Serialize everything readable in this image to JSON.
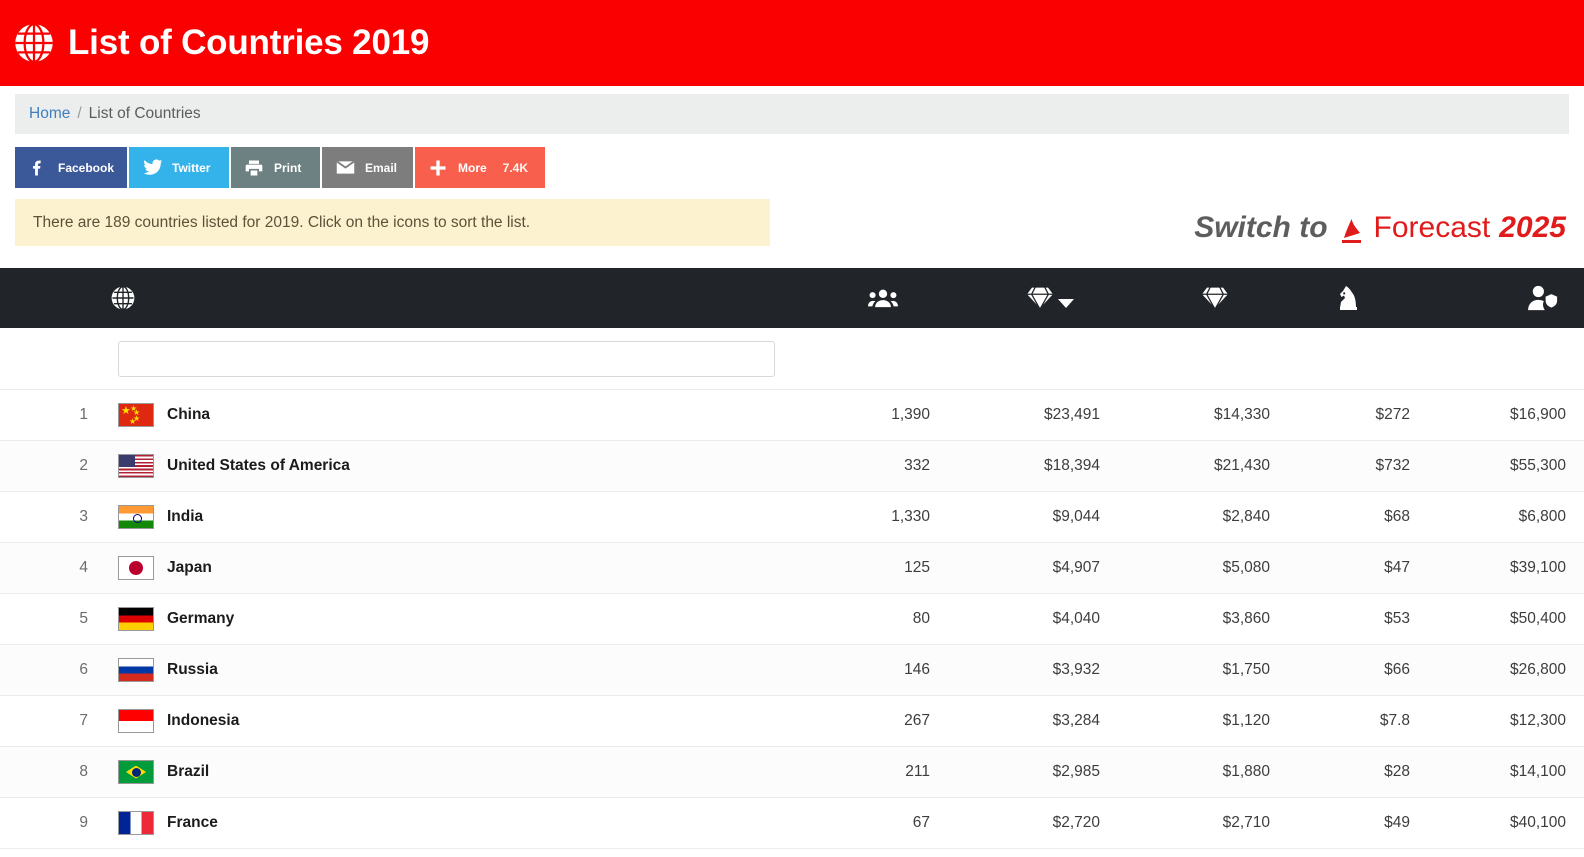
{
  "header": {
    "title": "List of Countries 2019",
    "logo_icon": "globe-icon",
    "background_color": "#fb0000"
  },
  "breadcrumb": {
    "home_label": "Home",
    "separator": "/",
    "current_label": "List of Countries"
  },
  "share_buttons": [
    {
      "name": "facebook",
      "label": "Facebook",
      "icon": "facebook-icon",
      "color": "#3b5998",
      "count": ""
    },
    {
      "name": "twitter",
      "label": "Twitter",
      "icon": "twitter-icon",
      "color": "#34b3eb",
      "count": ""
    },
    {
      "name": "print",
      "label": "Print",
      "icon": "printer-icon",
      "color": "#6d8183",
      "count": ""
    },
    {
      "name": "email",
      "label": "Email",
      "icon": "envelope-icon",
      "color": "#7d7d7d",
      "count": ""
    },
    {
      "name": "more",
      "label": "More",
      "icon": "plus-icon",
      "color": "#f8604d",
      "count": "7.4K"
    }
  ],
  "notice": {
    "text": "There are 189 countries listed for 2019. Click on the icons to sort the list.",
    "background_color": "#fdf2cf"
  },
  "forecast_link": {
    "prefix": "Switch to",
    "brand_icon": "a-mark-icon",
    "label": "Forecast",
    "year": "2025",
    "accent_color": "#e01b1b"
  },
  "table": {
    "header_background": "#212529",
    "columns": [
      {
        "key": "country",
        "icon": "globe-icon",
        "sorted": false,
        "sort_direction": ""
      },
      {
        "key": "population",
        "icon": "users-icon",
        "sorted": false,
        "sort_direction": ""
      },
      {
        "key": "gdp",
        "icon": "gem-icon",
        "sorted": true,
        "sort_direction": "desc"
      },
      {
        "key": "debt",
        "icon": "gem-icon",
        "sorted": false,
        "sort_direction": ""
      },
      {
        "key": "military",
        "icon": "chess-knight-icon",
        "sorted": false,
        "sort_direction": ""
      },
      {
        "key": "per_capita",
        "icon": "user-shield-icon",
        "sorted": false,
        "sort_direction": ""
      }
    ],
    "search": {
      "value": "",
      "placeholder": ""
    },
    "rows": [
      {
        "rank": "1",
        "flag": "cn",
        "country": "China",
        "population": "1,390",
        "gdp": "$23,491",
        "debt": "$14,330",
        "military": "$272",
        "per_capita": "$16,900"
      },
      {
        "rank": "2",
        "flag": "us",
        "country": "United States of America",
        "population": "332",
        "gdp": "$18,394",
        "debt": "$21,430",
        "military": "$732",
        "per_capita": "$55,300"
      },
      {
        "rank": "3",
        "flag": "in",
        "country": "India",
        "population": "1,330",
        "gdp": "$9,044",
        "debt": "$2,840",
        "military": "$68",
        "per_capita": "$6,800"
      },
      {
        "rank": "4",
        "flag": "jp",
        "country": "Japan",
        "population": "125",
        "gdp": "$4,907",
        "debt": "$5,080",
        "military": "$47",
        "per_capita": "$39,100"
      },
      {
        "rank": "5",
        "flag": "de",
        "country": "Germany",
        "population": "80",
        "gdp": "$4,040",
        "debt": "$3,860",
        "military": "$53",
        "per_capita": "$50,400"
      },
      {
        "rank": "6",
        "flag": "ru",
        "country": "Russia",
        "population": "146",
        "gdp": "$3,932",
        "debt": "$1,750",
        "military": "$66",
        "per_capita": "$26,800"
      },
      {
        "rank": "7",
        "flag": "id",
        "country": "Indonesia",
        "population": "267",
        "gdp": "$3,284",
        "debt": "$1,120",
        "military": "$7.8",
        "per_capita": "$12,300"
      },
      {
        "rank": "8",
        "flag": "br",
        "country": "Brazil",
        "population": "211",
        "gdp": "$2,985",
        "debt": "$1,880",
        "military": "$28",
        "per_capita": "$14,100"
      },
      {
        "rank": "9",
        "flag": "fr",
        "country": "France",
        "population": "67",
        "gdp": "$2,720",
        "debt": "$2,710",
        "military": "$49",
        "per_capita": "$40,100"
      }
    ]
  }
}
